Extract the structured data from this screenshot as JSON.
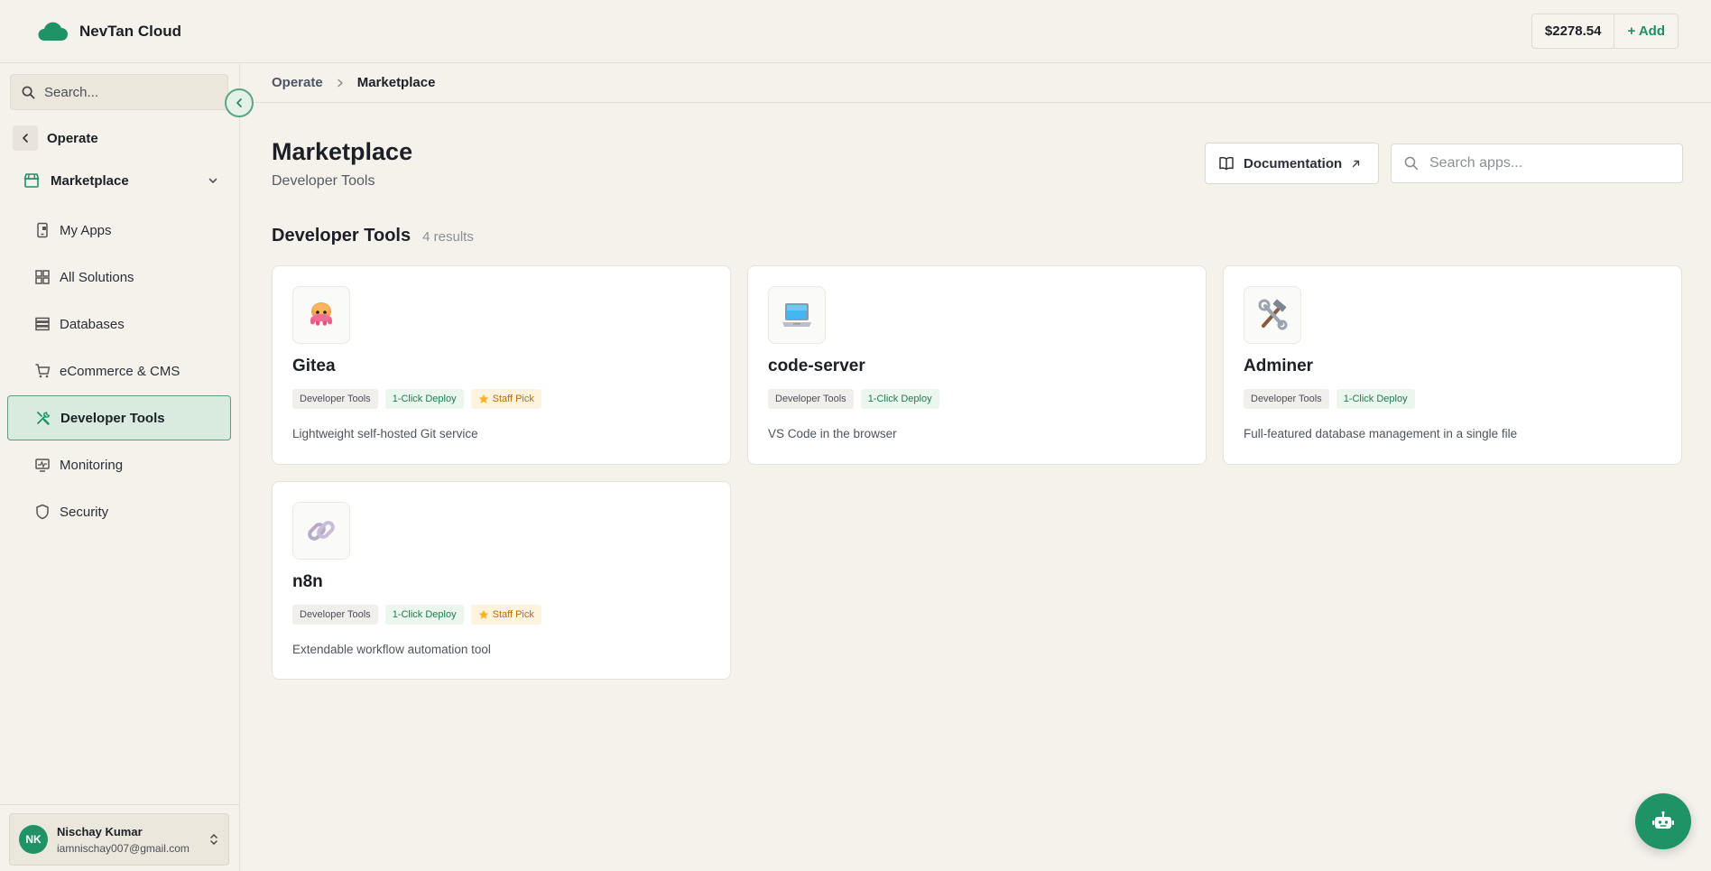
{
  "brand": {
    "name": "NevTan Cloud",
    "accent": "#1f9266"
  },
  "header": {
    "balance": "$2278.54",
    "add_label": "+ Add"
  },
  "sidebar": {
    "search_placeholder": "Search...",
    "back_label": "Operate",
    "parent": {
      "label": "Marketplace",
      "icon": "store-icon"
    },
    "items": [
      {
        "label": "My Apps",
        "icon": "mobile-app-icon"
      },
      {
        "label": "All Solutions",
        "icon": "grid-icon"
      },
      {
        "label": "Databases",
        "icon": "database-icon"
      },
      {
        "label": "eCommerce & CMS",
        "icon": "cart-icon"
      },
      {
        "label": "Developer Tools",
        "icon": "tools-icon",
        "active": true
      },
      {
        "label": "Monitoring",
        "icon": "monitor-icon"
      },
      {
        "label": "Security",
        "icon": "shield-icon"
      }
    ],
    "user": {
      "initials": "NK",
      "name": "Nischay Kumar",
      "email": "iamnischay007@gmail.com"
    }
  },
  "breadcrumb": {
    "parent": "Operate",
    "current": "Marketplace"
  },
  "page": {
    "title": "Marketplace",
    "subtitle": "Developer Tools",
    "doc_label": "Documentation",
    "search_placeholder": "Search apps..."
  },
  "section": {
    "title": "Developer Tools",
    "count": "4 results"
  },
  "apps": [
    {
      "name": "Gitea",
      "icon": "octopus-emoji-icon",
      "category": "Developer Tools",
      "deploy": "1-Click Deploy",
      "staff_pick": "Staff Pick",
      "description": "Lightweight self-hosted Git service"
    },
    {
      "name": "code-server",
      "icon": "laptop-emoji-icon",
      "category": "Developer Tools",
      "deploy": "1-Click Deploy",
      "description": "VS Code in the browser"
    },
    {
      "name": "Adminer",
      "icon": "hammer-wrench-emoji-icon",
      "category": "Developer Tools",
      "deploy": "1-Click Deploy",
      "description": "Full-featured database management in a single file"
    },
    {
      "name": "n8n",
      "icon": "link-emoji-icon",
      "category": "Developer Tools",
      "deploy": "1-Click Deploy",
      "staff_pick": "Staff Pick",
      "description": "Extendable workflow automation tool"
    }
  ]
}
